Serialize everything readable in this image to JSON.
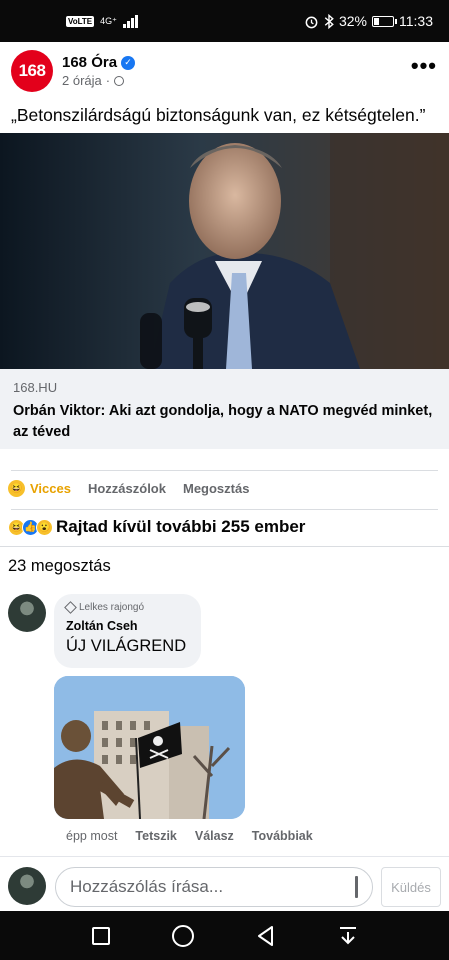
{
  "status_bar": {
    "volte": "VoLTE",
    "network": "4G⁺",
    "battery": "32%",
    "battery_level": 0.32,
    "time": "11:33"
  },
  "post": {
    "page_logo_text": "168",
    "page_name": "168 Óra",
    "time_ago": "2 órája",
    "separator": "·",
    "text": "„Betonszilárdságú biztonságunk van, ez kétségtelen.”",
    "link": {
      "domain": "168.HU",
      "title": "Orbán Viktor: Aki azt gondolja, hogy a NATO megvéd minket, az téved"
    },
    "actions": {
      "reaction_label": "Vicces",
      "comment_label": "Hozzászólok",
      "share_label": "Megosztás"
    },
    "reactions_text": "Rajtad kívül további 255 ember",
    "shares_text": "23 megosztás"
  },
  "comment": {
    "badge": "Lelkes rajongó",
    "author": "Zoltán Cseh",
    "text": "ÚJ VILÁGREND",
    "time": "épp most",
    "like_label": "Tetszik",
    "reply_label": "Válasz",
    "more_label": "Továbbiak"
  },
  "composer": {
    "placeholder": "Hozzászólás írása...",
    "send_label": "Küldés"
  },
  "icons": {
    "reaction_haha": "haha-emoji-icon",
    "reaction_like": "like-emoji-icon",
    "reaction_wow": "wow-emoji-icon"
  },
  "colors": {
    "brand_red": "#e3001b",
    "facebook_blue": "#1877f2",
    "haha_active": "#e8a200"
  }
}
